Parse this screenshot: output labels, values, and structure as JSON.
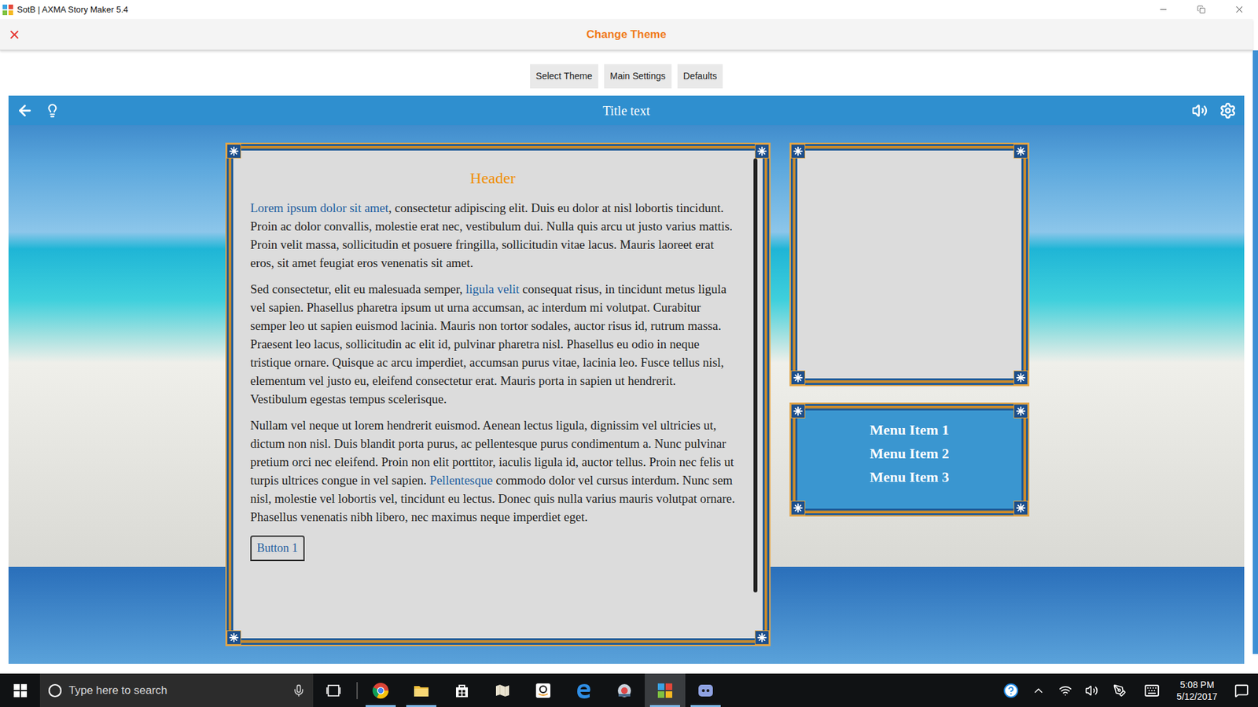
{
  "window": {
    "title": "SotB | AXMA Story Maker 5.4"
  },
  "header": {
    "title": "Change Theme"
  },
  "toolbar": {
    "buttons": [
      "Select Theme",
      "Main Settings",
      "Defaults"
    ]
  },
  "preview": {
    "title": "Title text",
    "content": {
      "header": "Header",
      "paragraphs": [
        [
          {
            "text": "Lorem ipsum dolor sit amet",
            "link": true
          },
          {
            "text": ", consectetur adipiscing elit. Duis eu dolor at nisl lobortis tincidunt. Proin ac dolor convallis, molestie erat nec, vestibulum dui. Nulla quis arcu ut justo varius mattis. Proin velit massa, sollicitudin et posuere fringilla, sollicitudin vitae lacus. Mauris laoreet erat eros, sit amet feugiat eros venenatis sit amet.",
            "link": false
          }
        ],
        [
          {
            "text": "Sed consectetur, elit eu malesuada semper, ",
            "link": false
          },
          {
            "text": "ligula velit",
            "link": true
          },
          {
            "text": " consequat risus, in tincidunt metus ligula vel sapien. Phasellus pharetra ipsum ut urna accumsan, ac interdum mi volutpat. Curabitur semper leo ut sapien euismod lacinia. Mauris non tortor sodales, auctor risus id, rutrum massa. Praesent leo lacus, sollicitudin ac elit id, pulvinar pharetra nisl. Phasellus eu odio in neque tristique ornare. Quisque ac arcu imperdiet, accumsan purus vitae, lacinia leo. Fusce tellus nisl, elementum vel justo eu, eleifend consectetur erat. Mauris porta in sapien ut hendrerit. Vestibulum egestas tempus scelerisque.",
            "link": false
          }
        ],
        [
          {
            "text": "Nullam vel neque ut lorem hendrerit euismod. Aenean lectus ligula, dignissim vel ultricies ut, dictum non nisl. Duis blandit porta purus, ac pellentesque purus condimentum a. Nunc pulvinar pretium orci nec eleifend. Proin non elit porttitor, iaculis ligula id, auctor tellus. Proin nec felis ut turpis ultrices congue in vel sapien. ",
            "link": false
          },
          {
            "text": "Pellentesque",
            "link": true
          },
          {
            "text": " commodo dolor vel cursus interdum. Nunc sem nisl, molestie vel lobortis vel, tincidunt eu lectus. Donec quis nulla varius mauris volutpat ornare. Phasellus venenatis nibh libero, nec maximus neque imperdiet eget.",
            "link": false
          }
        ]
      ],
      "button": "Button 1"
    },
    "menu": [
      "Menu Item 1",
      "Menu Item 2",
      "Menu Item 3"
    ]
  },
  "taskbar": {
    "search_placeholder": "Type here to search",
    "apps": [
      {
        "running": true,
        "active": false
      },
      {
        "running": true,
        "active": false
      },
      {
        "running": false,
        "active": false
      },
      {
        "running": false,
        "active": false
      },
      {
        "running": false,
        "active": false
      },
      {
        "running": false,
        "active": false
      },
      {
        "running": false,
        "active": false
      },
      {
        "running": true,
        "active": true
      },
      {
        "running": true,
        "active": false
      }
    ],
    "time": "5:08 PM",
    "date": "5/12/2017"
  }
}
